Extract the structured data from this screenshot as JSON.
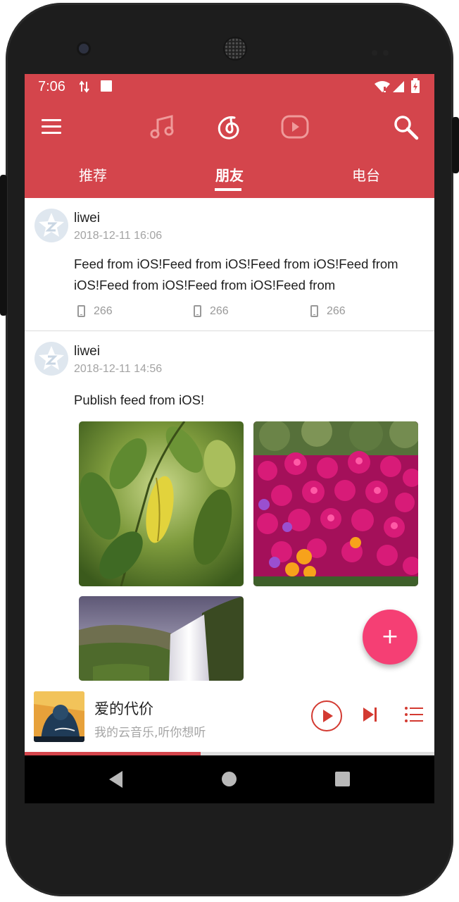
{
  "status_bar": {
    "time": "7:06"
  },
  "top_nav": {
    "icons": [
      "menu-icon",
      "music-note-icon",
      "netease-logo-icon",
      "video-play-icon",
      "search-icon"
    ]
  },
  "tabs": [
    {
      "label": "推荐",
      "active": false
    },
    {
      "label": "朋友",
      "active": true
    },
    {
      "label": "电台",
      "active": false
    }
  ],
  "feed": [
    {
      "username": "liwei",
      "datetime": "2018-12-11 16:06",
      "text": "Feed from iOS!Feed from iOS!Feed from iOS!Feed from iOS!Feed from iOS!Feed from iOS!Feed from",
      "stats": [
        "266",
        "266",
        "266"
      ]
    },
    {
      "username": "liwei",
      "datetime": "2018-12-11 14:56",
      "text": "Publish feed from iOS!",
      "photos": [
        "leaves-photo",
        "pink-flowers-photo",
        "waterfall-photo"
      ]
    }
  ],
  "fab": {
    "label": "+"
  },
  "player": {
    "title": "爱的代价",
    "subtitle": "我的云音乐,听你想听",
    "progress": 0.43
  },
  "colors": {
    "brand": "#d4454c",
    "fab": "#f53f74",
    "player_accent": "#d33a31"
  }
}
